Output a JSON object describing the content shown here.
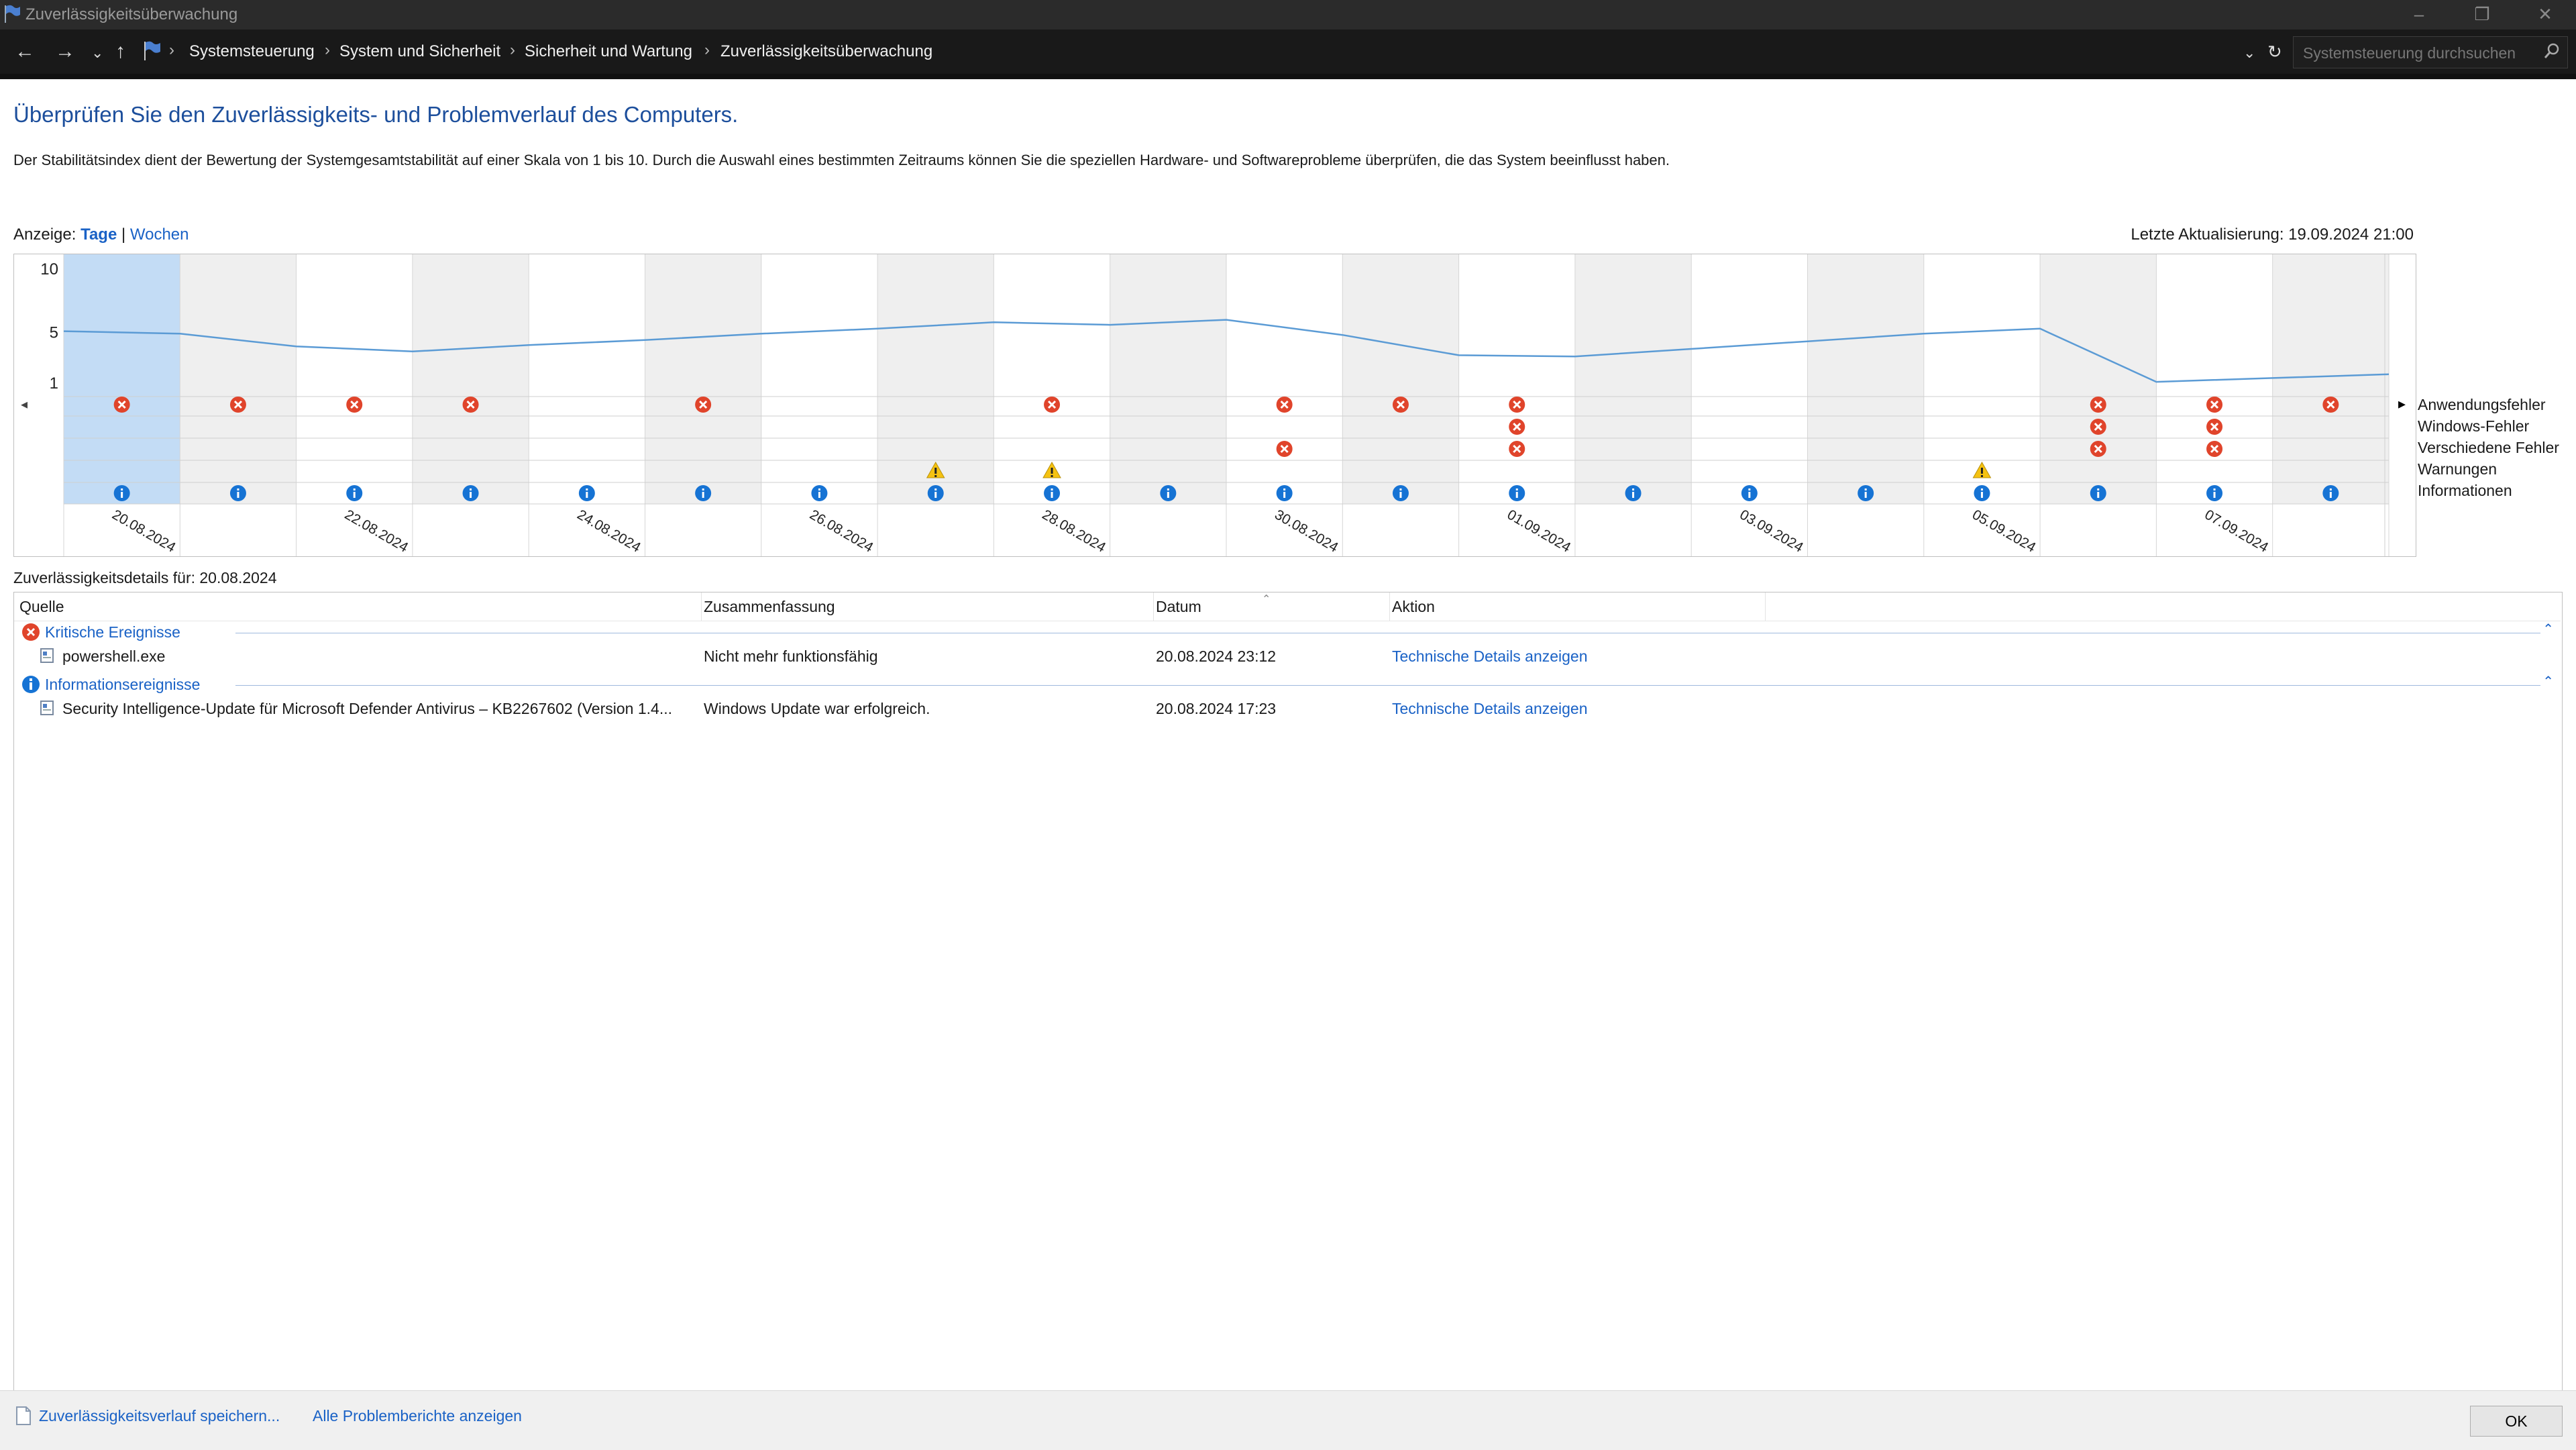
{
  "window": {
    "title": "Zuverlässigkeitsüberwachung"
  },
  "nav": {
    "breadcrumbs": [
      "Systemsteuerung",
      "System und Sicherheit",
      "Sicherheit und Wartung",
      "Zuverlässigkeitsüberwachung"
    ],
    "search_placeholder": "Systemsteuerung durchsuchen"
  },
  "page": {
    "heading": "Überprüfen Sie den Zuverlässigkeits- und Problemverlauf des Computers.",
    "description": "Der Stabilitätsindex dient der Bewertung der Systemgesamtstabilität auf einer Skala von 1 bis 10. Durch die Auswahl eines bestimmten Zeitraums können Sie die speziellen Hardware- und Softwareprobleme überprüfen, die das System beeinflusst haben.",
    "view_label": "Anzeige:",
    "view_days": "Tage",
    "view_sep": "|",
    "view_weeks": "Wochen",
    "last_update": "Letzte Aktualisierung: 19.09.2024 21:00"
  },
  "chart_data": {
    "type": "line",
    "y_ticks": [
      "10",
      "5",
      "1"
    ],
    "ylim": [
      1,
      10
    ],
    "selected_day_index": 0,
    "x_tick_labels": [
      "20.08.2024",
      "22.08.2024",
      "24.08.2024",
      "26.08.2024",
      "28.08.2024",
      "30.08.2024",
      "01.09.2024",
      "03.09.2024",
      "05.09.2024",
      "07.09.2024"
    ],
    "days": [
      "20.08",
      "21.08",
      "22.08",
      "23.08",
      "24.08",
      "25.08",
      "26.08",
      "27.08",
      "28.08",
      "29.08",
      "30.08",
      "31.08",
      "01.09",
      "02.09",
      "03.09",
      "04.09",
      "05.09",
      "06.09",
      "07.09",
      "08.09"
    ],
    "stability_index": [
      5.1,
      4.9,
      3.9,
      3.5,
      4.0,
      4.4,
      4.9,
      5.3,
      5.8,
      5.6,
      6.0,
      4.8,
      3.2,
      3.1,
      3.7,
      4.3,
      4.9,
      5.3,
      1.1,
      1.4,
      1.7
    ],
    "categories": [
      "Anwendungsfehler",
      "Windows-Fehler",
      "Verschiedene Fehler",
      "Warnungen",
      "Informationen"
    ],
    "events": {
      "Anwendungsfehler": [
        0,
        1,
        2,
        3,
        5,
        8,
        10,
        11,
        12,
        17,
        18,
        19
      ],
      "Windows-Fehler": [
        12,
        17,
        18
      ],
      "Verschiedene Fehler": [
        10,
        12,
        17,
        18
      ],
      "Warnungen": [
        7,
        8,
        16
      ],
      "Informationen": [
        0,
        1,
        2,
        3,
        4,
        5,
        6,
        7,
        8,
        9,
        10,
        11,
        12,
        13,
        14,
        15,
        16,
        17,
        18,
        19
      ]
    }
  },
  "details": {
    "title": "Zuverlässigkeitsdetails für: 20.08.2024",
    "columns": [
      "Quelle",
      "Zusammenfassung",
      "Datum",
      "Aktion"
    ],
    "groups": [
      {
        "name": "Kritische Ereignisse",
        "icon": "error-icon",
        "rows": [
          {
            "source": "powershell.exe",
            "summary": "Nicht mehr funktionsfähig",
            "date": "20.08.2024 23:12",
            "action": "Technische Details anzeigen"
          }
        ]
      },
      {
        "name": "Informationsereignisse",
        "icon": "info-icon",
        "rows": [
          {
            "source": "Security Intelligence-Update für Microsoft Defender Antivirus – KB2267602 (Version 1.4...",
            "summary": "Windows Update war erfolgreich.",
            "date": "20.08.2024 17:23",
            "action": "Technische Details anzeigen"
          }
        ]
      }
    ]
  },
  "footer": {
    "save_link": "Zuverlässigkeitsverlauf speichern...",
    "reports_link": "Alle Problemberichte anzeigen",
    "ok": "OK"
  },
  "colors": {
    "accent": "#1a62c6",
    "error": "#e0442b",
    "warning": "#f5c211",
    "info": "#1673d4",
    "line": "#5b9bd5",
    "selected": "#c3dcf5"
  }
}
